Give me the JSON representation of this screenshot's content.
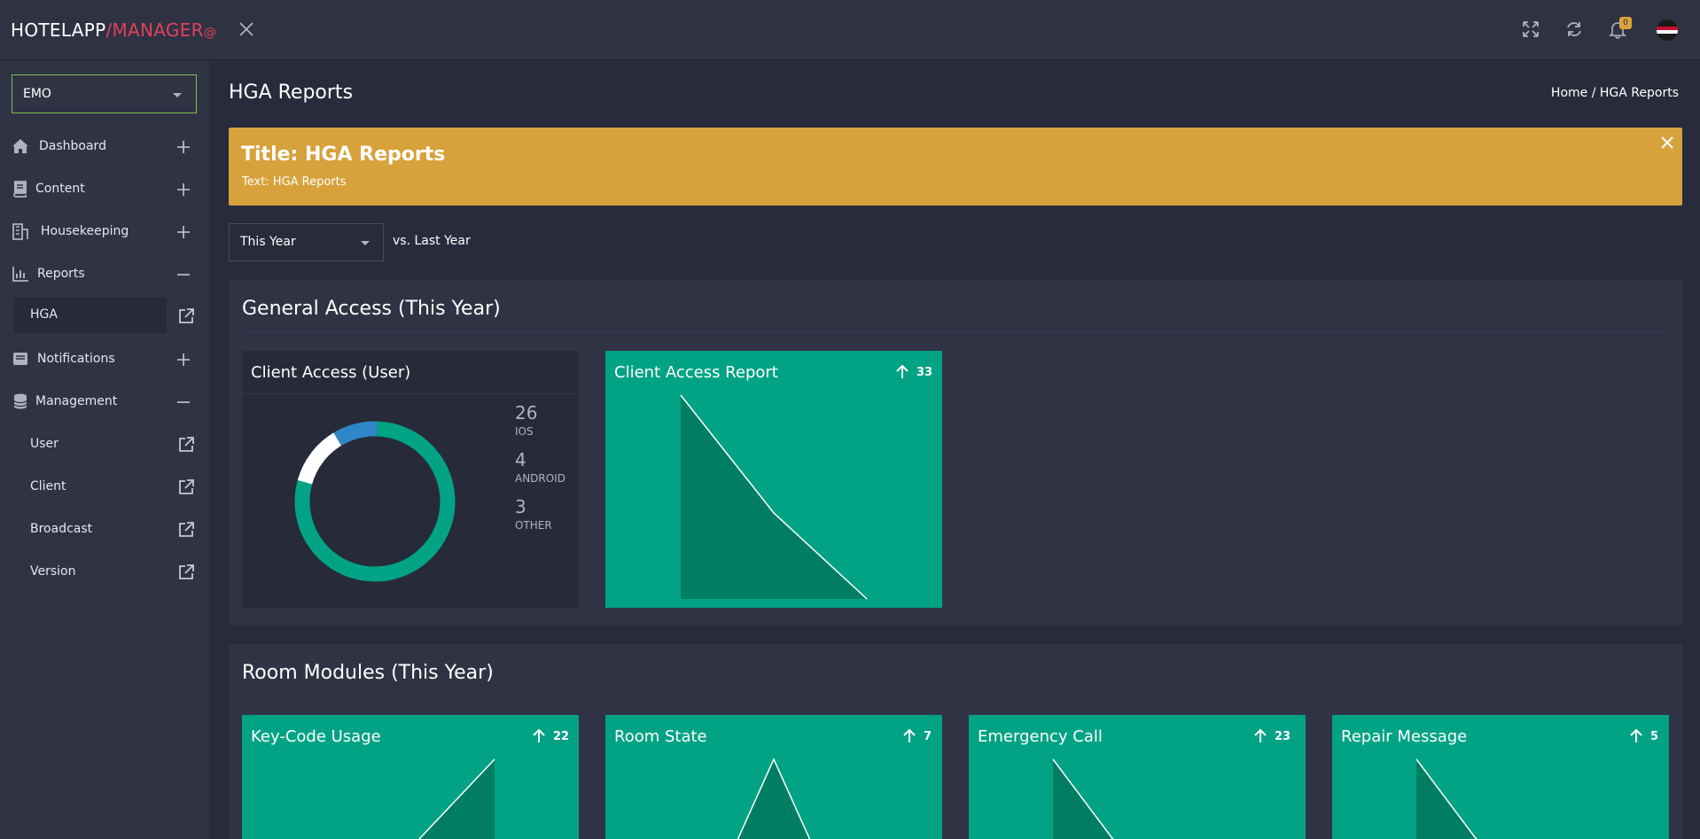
{
  "app": {
    "logo_part1": "HOTELAPP",
    "logo_part2": "/MANAGER",
    "logo_mark": "@",
    "notification_count": "0"
  },
  "sidebar": {
    "hotel_select": "EMO",
    "items": [
      {
        "label": "Dashboard",
        "icon": "home-icon",
        "state": "collapsed"
      },
      {
        "label": "Content",
        "icon": "book-icon",
        "state": "collapsed"
      },
      {
        "label": "Housekeeping",
        "icon": "building-icon",
        "state": "collapsed"
      },
      {
        "label": "Reports",
        "icon": "bar-chart-icon",
        "state": "expanded"
      },
      {
        "label": "Notifications",
        "icon": "inbox-icon",
        "state": "collapsed"
      },
      {
        "label": "Management",
        "icon": "database-icon",
        "state": "expanded"
      }
    ],
    "reports_sub": [
      {
        "label": "HGA"
      }
    ],
    "management_sub": [
      {
        "label": "User"
      },
      {
        "label": "Client"
      },
      {
        "label": "Broadcast"
      },
      {
        "label": "Version"
      }
    ]
  },
  "page": {
    "title": "HGA Reports",
    "breadcrumb": "Home / HGA Reports"
  },
  "alert": {
    "title": "Title: HGA Reports",
    "text": "Text: HGA Reports"
  },
  "filter": {
    "period": "This Year",
    "comparison": "vs. Last Year"
  },
  "general_access": {
    "heading": "General Access (This Year)",
    "client_access_user": {
      "title": "Client Access (User)",
      "stats": [
        {
          "value": "26",
          "label": "IOS"
        },
        {
          "value": "4",
          "label": "ANDROID"
        },
        {
          "value": "3",
          "label": "OTHER"
        }
      ]
    },
    "client_access_report": {
      "title": "Client Access Report",
      "trend": "33"
    }
  },
  "room_modules": {
    "heading": "Room Modules (This Year)",
    "cards": [
      {
        "title": "Key-Code Usage",
        "trend": "22"
      },
      {
        "title": "Room State",
        "trend": "7"
      },
      {
        "title": "Emergency Call",
        "trend": "23"
      },
      {
        "title": "Repair Message",
        "trend": "5"
      }
    ]
  },
  "colors": {
    "accent_green": "#01a384",
    "alert_yellow": "#d7a23b",
    "brand_red": "#e0425a",
    "donut_ios": "#01a384",
    "donut_android": "#ffffff",
    "donut_other": "#2f86c8"
  },
  "chart_data": [
    {
      "type": "pie",
      "categories": [
        "IOS",
        "ANDROID",
        "OTHER"
      ],
      "values": [
        26,
        4,
        3
      ]
    }
  ]
}
